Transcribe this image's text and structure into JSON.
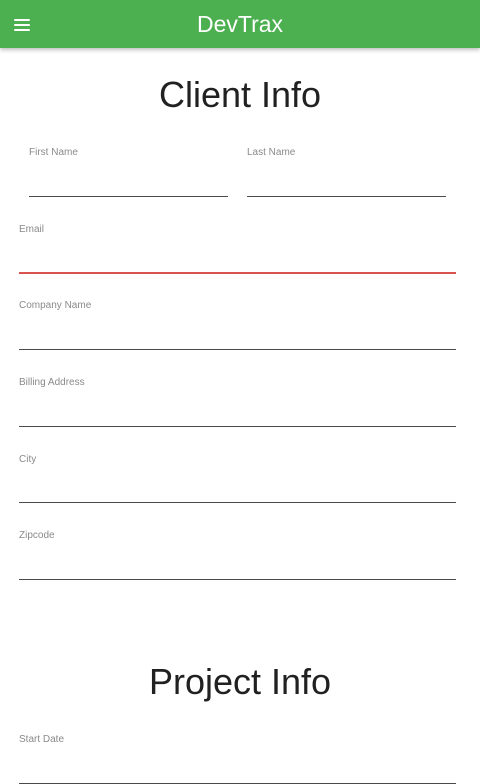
{
  "app": {
    "title": "DevTrax",
    "accent_color": "#4caf50",
    "menu_icon": "hamburger-menu-icon"
  },
  "client_section": {
    "title": "Client Info",
    "fields": {
      "first_name": {
        "label": "First Name",
        "value": ""
      },
      "last_name": {
        "label": "Last Name",
        "value": ""
      },
      "email": {
        "label": "Email",
        "value": "",
        "state": "error",
        "error_color": "#d9534f"
      },
      "company_name": {
        "label": "Company Name",
        "value": ""
      },
      "billing_address": {
        "label": "Billing Address",
        "value": ""
      },
      "city": {
        "label": "City",
        "value": ""
      },
      "zipcode": {
        "label": "Zipcode",
        "value": ""
      }
    }
  },
  "project_section": {
    "title": "Project Info",
    "fields": {
      "start_date": {
        "label": "Start Date",
        "value": ""
      }
    }
  }
}
